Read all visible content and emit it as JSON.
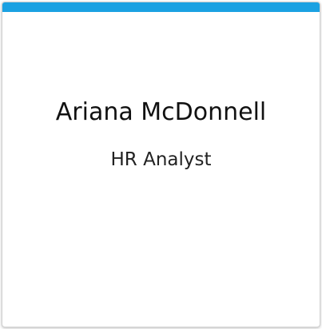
{
  "card": {
    "name": "Ariana McDonnell",
    "title": "HR Analyst",
    "accent_color": "#1ba1e2"
  }
}
